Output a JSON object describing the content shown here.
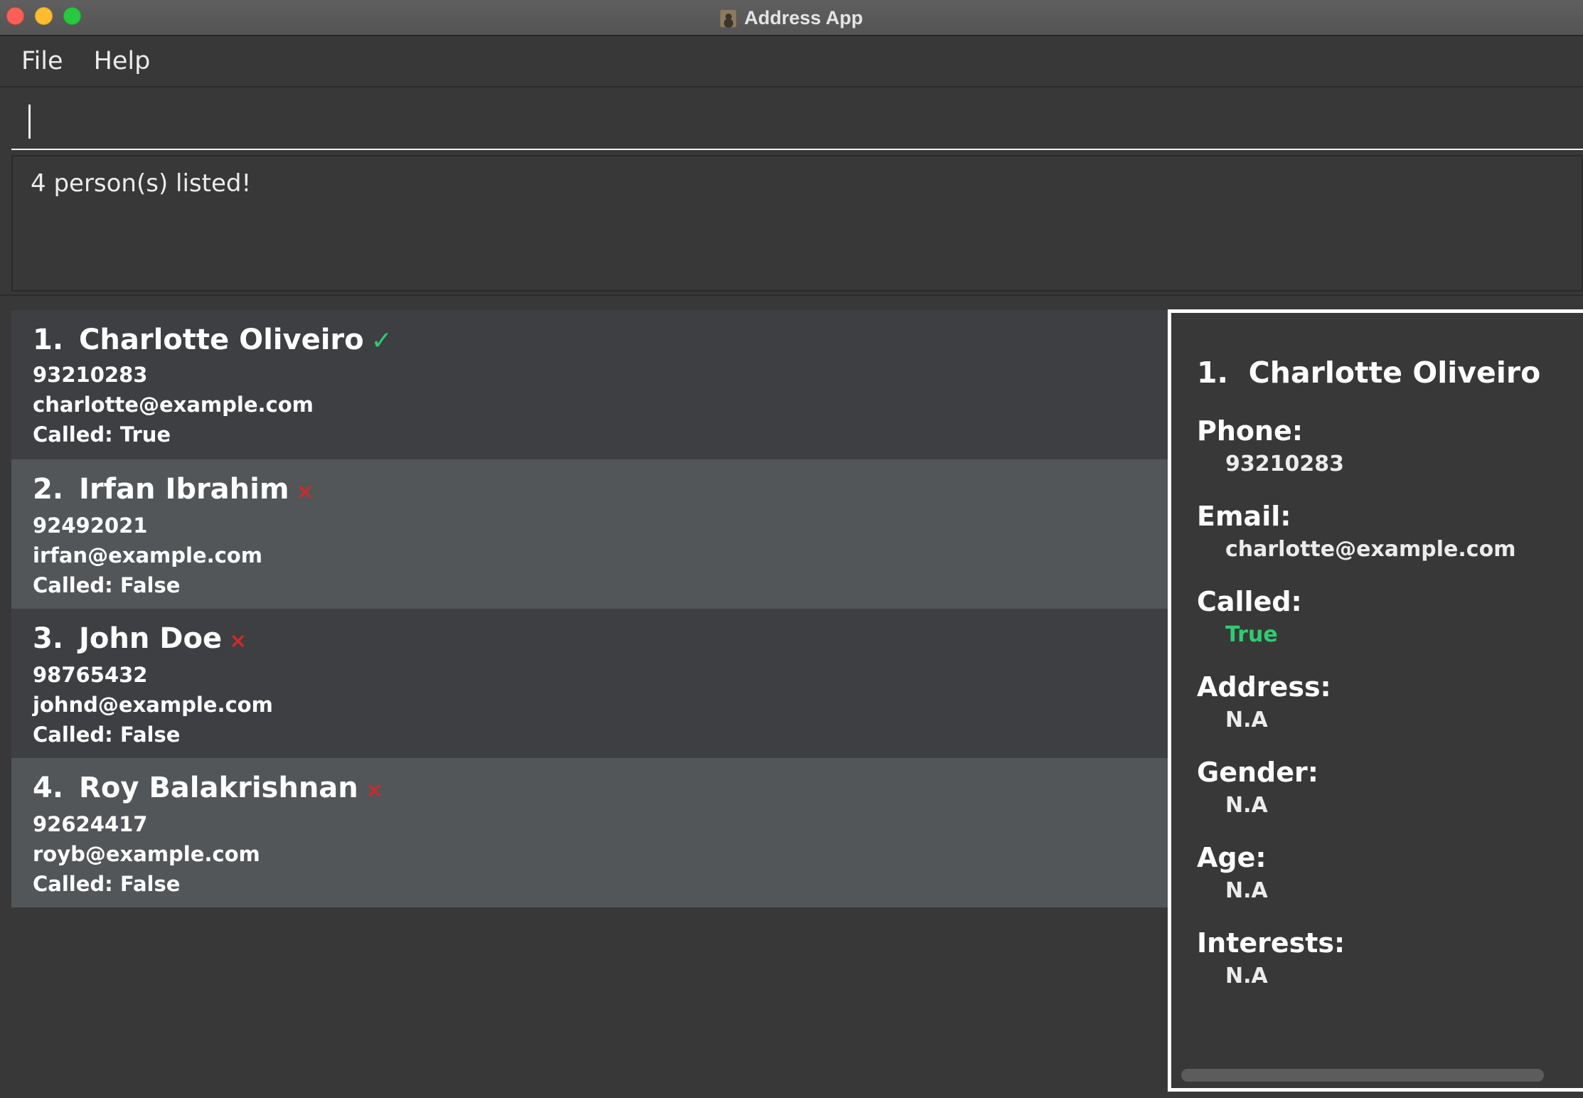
{
  "window": {
    "title": "Address App",
    "app_icon": "address-book-icon"
  },
  "menu": {
    "file_label": "File",
    "help_label": "Help"
  },
  "command": {
    "value": "",
    "placeholder": ""
  },
  "result": {
    "message": "4 person(s) listed!"
  },
  "colors": {
    "called_true": "#2ecc71",
    "called_false": "#cc2a2a",
    "card_odd": "#3d3f42",
    "card_even": "#525659",
    "background": "#383838"
  },
  "persons": [
    {
      "index": "1.",
      "name": "Charlotte Oliveiro",
      "status_icon": "✓",
      "status": "called",
      "phone": "93210283",
      "email": "charlotte@example.com",
      "called_text": "Called: True"
    },
    {
      "index": "2.",
      "name": "Irfan Ibrahim",
      "status_icon": "×",
      "status": "not-called",
      "phone": "92492021",
      "email": "irfan@example.com",
      "called_text": "Called: False"
    },
    {
      "index": "3.",
      "name": "John Doe",
      "status_icon": "×",
      "status": "not-called",
      "phone": "98765432",
      "email": "johnd@example.com",
      "called_text": "Called: False"
    },
    {
      "index": "4.",
      "name": "Roy Balakrishnan",
      "status_icon": "×",
      "status": "not-called",
      "phone": "92624417",
      "email": "royb@example.com",
      "called_text": "Called: False"
    }
  ],
  "detail": {
    "index": "1.",
    "name": "Charlotte Oliveiro",
    "fields": [
      {
        "label": "Phone:",
        "value": "93210283"
      },
      {
        "label": "Email:",
        "value": "charlotte@example.com"
      },
      {
        "label": "Called:",
        "value": "True"
      },
      {
        "label": "Address:",
        "value": "N.A"
      },
      {
        "label": "Gender:",
        "value": "N.A"
      },
      {
        "label": "Age:",
        "value": "N.A"
      },
      {
        "label": "Interests:",
        "value": "N.A"
      }
    ]
  }
}
